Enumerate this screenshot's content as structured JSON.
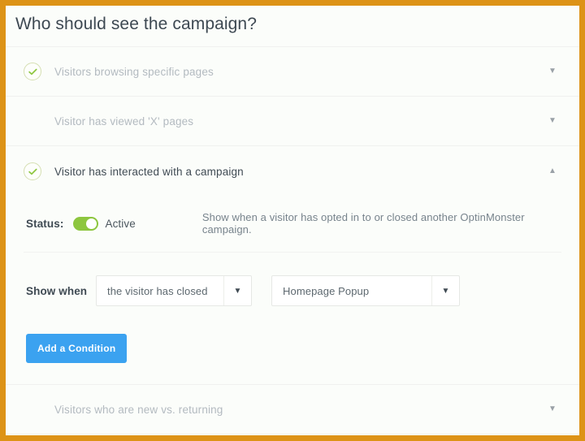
{
  "page": {
    "title": "Who should see the campaign?",
    "accent_orange": "#dd9317",
    "accent_blue": "#3ba2f0",
    "accent_green": "#8dc63f"
  },
  "conditions": [
    {
      "label": "Visitors browsing specific pages",
      "icon": "check-circle-icon",
      "state": "enabled",
      "chevron": "▼",
      "chevron_name": "chevron-down-icon",
      "expanded": false
    },
    {
      "label": "Visitor has viewed 'X' pages",
      "icon": "dot-icon",
      "state": "disabled",
      "chevron": "▼",
      "chevron_name": "chevron-down-icon",
      "expanded": false
    },
    {
      "label": "Visitor has interacted with a campaign",
      "icon": "check-circle-icon",
      "state": "enabled",
      "chevron": "▲",
      "chevron_name": "chevron-up-icon",
      "expanded": true
    },
    {
      "label": "Visitors who are new vs. returning",
      "icon": "dot-icon",
      "state": "disabled",
      "chevron": "▼",
      "chevron_name": "chevron-down-icon",
      "expanded": false
    }
  ],
  "expanded_panel": {
    "status_label": "Status:",
    "toggle_state_text": "Active",
    "toggle_on": true,
    "hint": "Show when a visitor has opted in to or closed another OptinMonster campaign.",
    "form": {
      "label": "Show when",
      "select_event": {
        "value": "the visitor has closed",
        "caret": "▼"
      },
      "select_campaign": {
        "value": "Homepage Popup",
        "caret": "▼"
      }
    },
    "add_condition_label": "Add a Condition"
  }
}
